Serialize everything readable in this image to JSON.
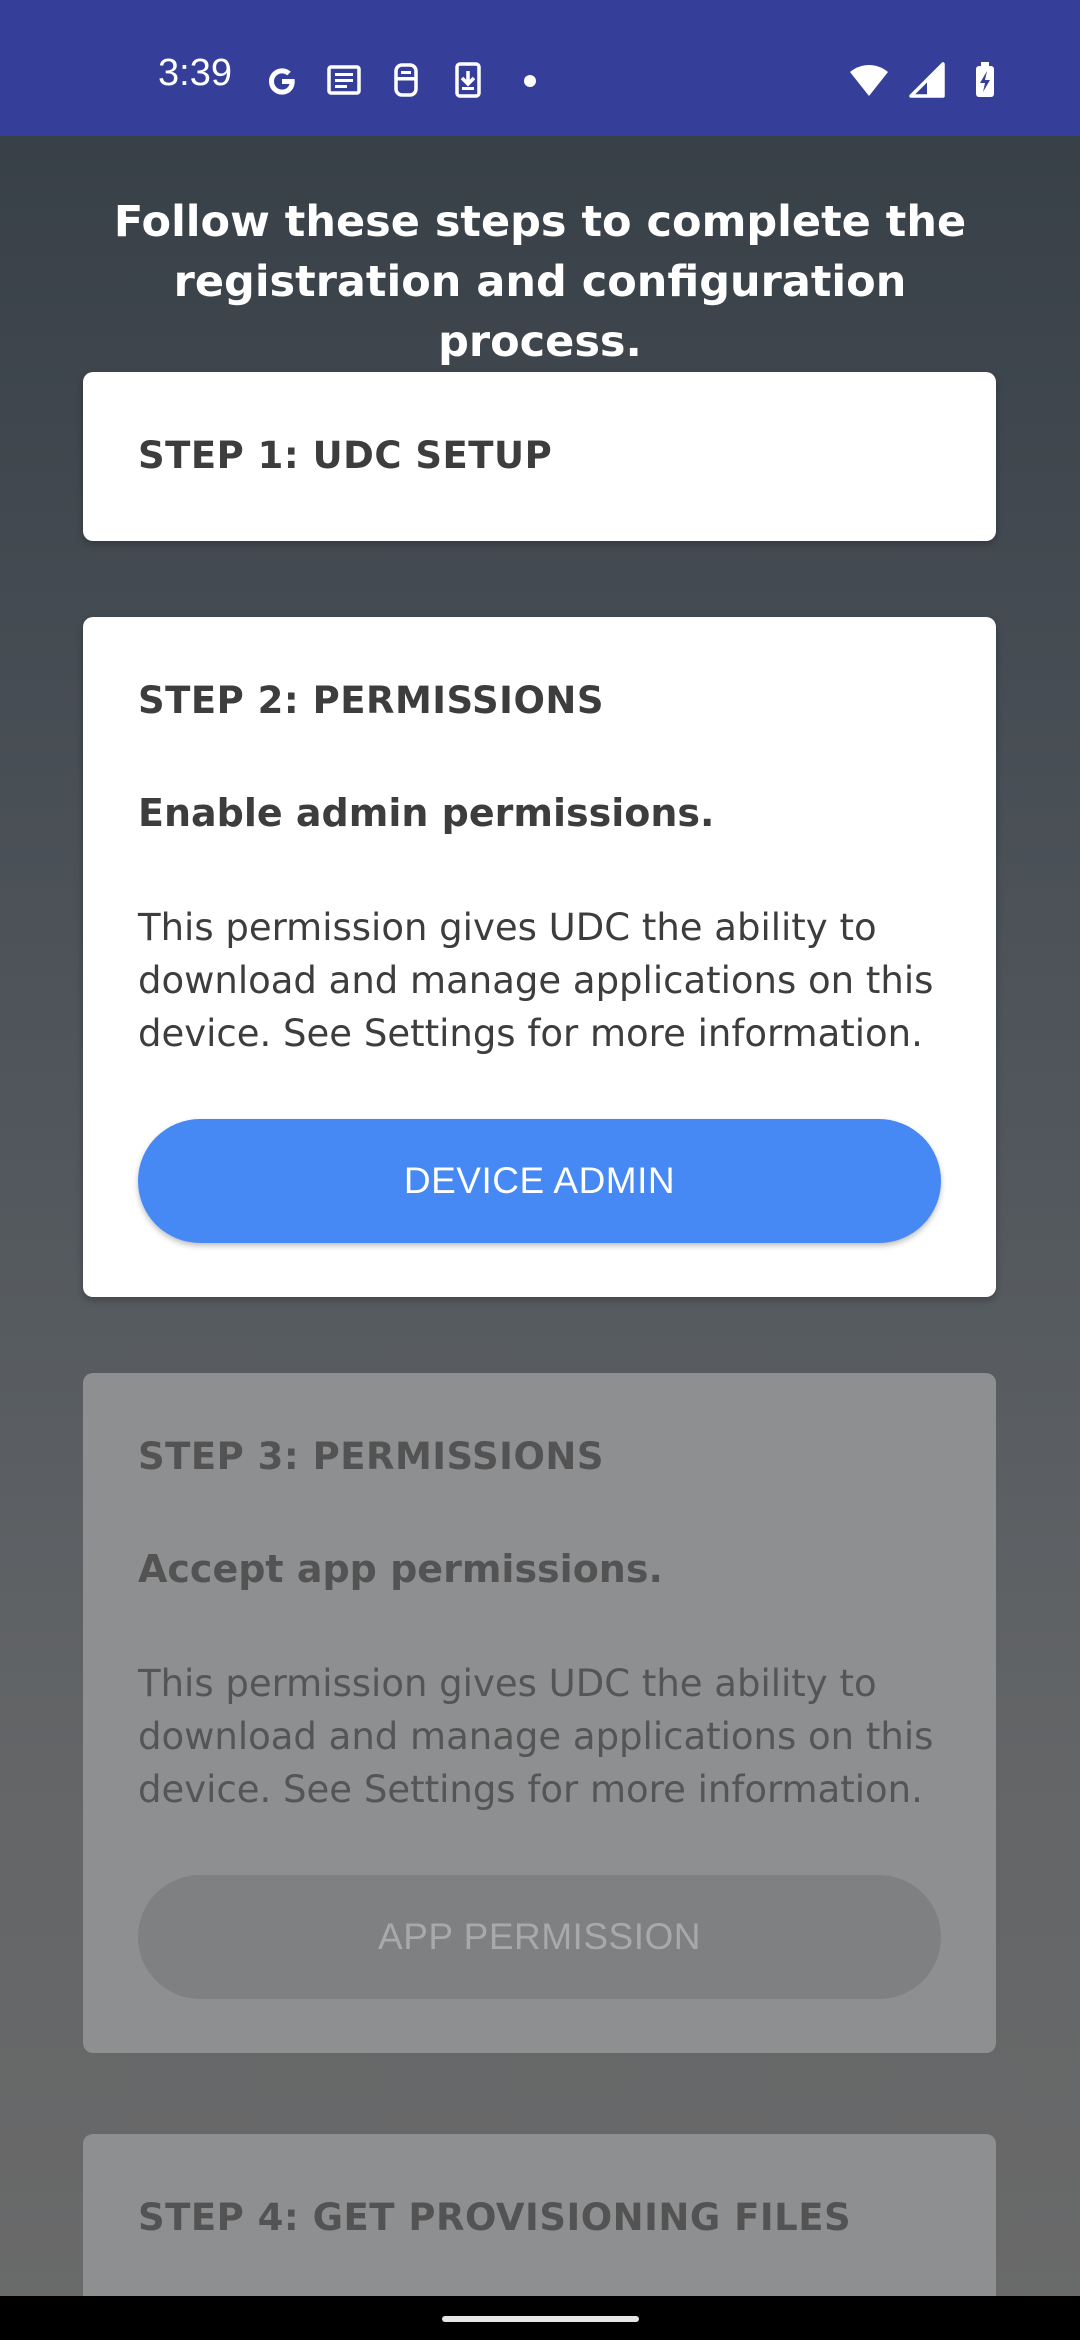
{
  "status_bar": {
    "time": "3:39",
    "icons_left": [
      "google-icon",
      "news-icon",
      "vpn-icon",
      "download-icon",
      "dot-icon"
    ],
    "icons_right": [
      "wifi-icon",
      "signal-icon",
      "battery-charging-icon"
    ],
    "color": "#353f99"
  },
  "intro": {
    "text": "Follow these steps to complete the registration and configuration process."
  },
  "steps": [
    {
      "title": "STEP 1: UDC SETUP"
    },
    {
      "title": "STEP 2: PERMISSIONS",
      "subtitle": "Enable admin permissions.",
      "body": "This permission gives UDC the ability to download and manage applications on this device. See Settings for more information.",
      "button_label": "DEVICE ADMIN",
      "button_color": "#4688f4"
    },
    {
      "title": "STEP 3: PERMISSIONS",
      "subtitle": "Accept app permissions.",
      "body": "This permission gives UDC the ability to download and manage applications on this device. See Settings for more information.",
      "button_label": "APP PERMISSION",
      "enabled": false
    },
    {
      "title": "STEP 4: GET PROVISIONING FILES",
      "enabled": false
    }
  ]
}
